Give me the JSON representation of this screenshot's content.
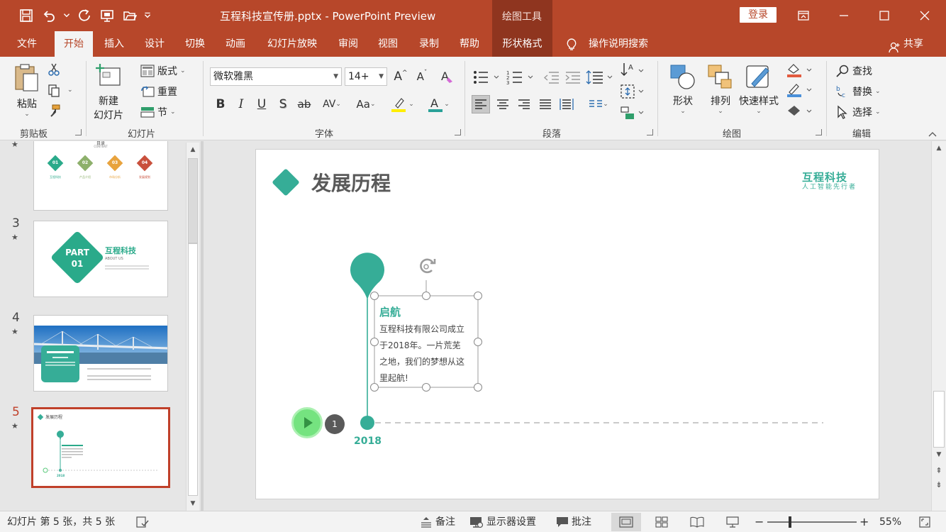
{
  "window": {
    "doc_title": "互程科技宣传册.pptx - PowerPoint Preview",
    "context_tab_group": "绘图工具",
    "login_label": "登录"
  },
  "tabs": [
    {
      "label": "文件"
    },
    {
      "label": "开始"
    },
    {
      "label": "插入"
    },
    {
      "label": "设计"
    },
    {
      "label": "切换"
    },
    {
      "label": "动画"
    },
    {
      "label": "幻灯片放映"
    },
    {
      "label": "审阅"
    },
    {
      "label": "视图"
    },
    {
      "label": "录制"
    },
    {
      "label": "帮助"
    },
    {
      "label": "形状格式"
    }
  ],
  "active_tab": "开始",
  "tell_me": "操作说明搜索",
  "share_label": "共享",
  "ribbon": {
    "clipboard": {
      "paste": "粘贴",
      "group": "剪贴板"
    },
    "slides": {
      "new_slide_line1": "新建",
      "new_slide_line2": "幻灯片",
      "layout": "版式",
      "reset": "重置",
      "section": "节",
      "group": "幻灯片"
    },
    "font": {
      "font_name": "微软雅黑",
      "font_size": "14+",
      "group": "字体"
    },
    "paragraph": {
      "group": "段落"
    },
    "drawing": {
      "shape": "形状",
      "arrange": "排列",
      "quick_styles": "快速样式",
      "group": "绘图"
    },
    "editing": {
      "find": "查找",
      "replace": "替换",
      "select": "选择",
      "group": "编辑"
    }
  },
  "thumbnails": [
    {
      "num": "",
      "title": "目录",
      "subtitle": "CONTENT",
      "items": [
        {
          "n": "01",
          "label": "互程科技",
          "color": "#2aaa8a"
        },
        {
          "n": "02",
          "label": "产品介绍",
          "color": "#8db06b"
        },
        {
          "n": "03",
          "label": "市场分析",
          "color": "#e8a33d"
        },
        {
          "n": "04",
          "label": "发展规划",
          "color": "#c9503c"
        }
      ]
    },
    {
      "num": "3",
      "part": "PART",
      "part_num": "01",
      "title": "互程科技",
      "subtitle": "ABOUT US"
    },
    {
      "num": "4"
    },
    {
      "num": "5",
      "title": "发展历程",
      "year": "2018"
    }
  ],
  "slide": {
    "title": "发展历程",
    "logo_main": "互程科技",
    "logo_sub": "人工智能先行者",
    "milestone_title": "启航",
    "milestone_lines": [
      "互程科技有限公司成立",
      "于2018年。一片荒芜",
      "之地，我们的梦想从这",
      "里起航!"
    ],
    "year": "2018",
    "animation_badge": "1",
    "accent_color": "#36ad97"
  },
  "status": {
    "slide_info": "幻灯片 第 5 张，共 5 张",
    "notes": "备注",
    "display_settings": "显示器设置",
    "comments": "批注",
    "zoom_percent": "55%",
    "zoom_level": 0.55
  }
}
